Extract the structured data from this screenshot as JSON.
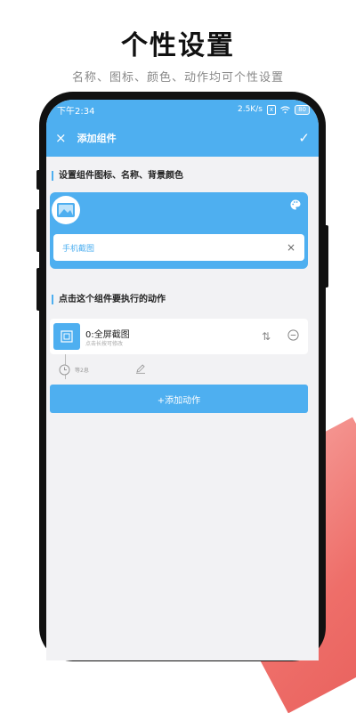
{
  "promo": {
    "title": "个性设置",
    "subtitle": "名称、图标、颜色、动作均可个性设置"
  },
  "status_bar": {
    "time": "下午2:34",
    "net_speed": "2.5K/s",
    "sim_icon": "x",
    "wifi_icon": "wifi-icon",
    "battery": "80"
  },
  "toolbar": {
    "title": "添加组件",
    "close_icon": "×",
    "confirm_icon": "✓"
  },
  "section1": {
    "label": "设置组件图标、名称、背景颜色"
  },
  "widget": {
    "name_value": "手机截图",
    "clear_icon": "×"
  },
  "section2": {
    "label": "点击这个组件要执行的动作"
  },
  "action": {
    "name": "0:全屏截图",
    "subtitle": "点击长按可修改",
    "sort_icon": "⇅",
    "delay": "等2息"
  },
  "add_action": {
    "label": "+添加动作"
  },
  "colors": {
    "primary": "#4eaff0",
    "accent_pink": "#ee6e69",
    "background": "#f2f2f4"
  }
}
